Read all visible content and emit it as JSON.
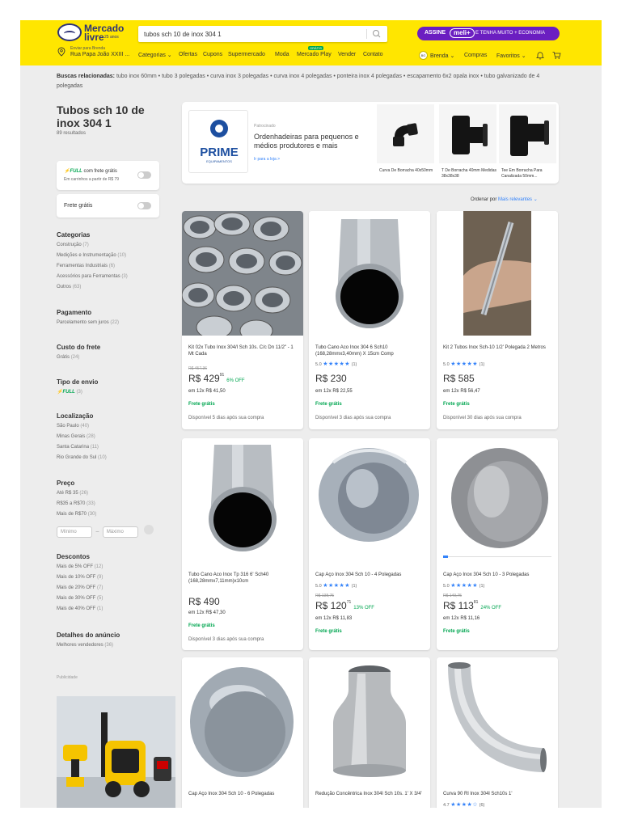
{
  "header": {
    "logo_line1": "Mercado",
    "logo_line2": "livre",
    "logo_line3": "25 anos",
    "search_value": "tubos sch 10 de inox 304 1",
    "promo_assine": "ASSINE",
    "promo_meli": "meli+",
    "promo_text": "E TENHA MUITO + ECONOMIA",
    "location_line1": "Enviar para Brenda",
    "location_line2": "Rua Papa João XXIII ...",
    "nav": [
      "Categorias ⌄",
      "Ofertas",
      "Cupons",
      "Supermercado",
      "Moda",
      "Mercado Play",
      "Vender",
      "Contato"
    ],
    "nav_badge": "GRÁTIS",
    "avatar_initials": "BG",
    "account": [
      "Brenda ⌄",
      "Compras",
      "Favoritos ⌄"
    ]
  },
  "related": {
    "label": "Buscas relacionadas:",
    "items": "tubo inox 60mm  •  tubo 3 polegadas  •  curva inox 3 polegadas  •  curva inox 4 polegadas  •  ponteira inox 4 polegadas  •  escapamento 6x2 opala inox  •  tubo galvanizado de 4 polegadas"
  },
  "left": {
    "title": "Tubos sch 10 de inox 304 1",
    "results": "89 resultados",
    "full_badge": "⚡FULL",
    "full_label": "com frete grátis",
    "full_sub": "Em carrinhos a partir de R$ 79",
    "frete_label": "Frete grátis",
    "filters": [
      {
        "title": "Categorias",
        "items": [
          [
            "Construção",
            "(7)"
          ],
          [
            "Medições e Instrumentação",
            "(10)"
          ],
          [
            "Ferramentas Industriais",
            "(6)"
          ],
          [
            "Acessórios para Ferramentas",
            "(3)"
          ],
          [
            "Outros",
            "(63)"
          ]
        ]
      },
      {
        "title": "Pagamento",
        "items": [
          [
            "Parcelamento sem juros",
            "(22)"
          ]
        ]
      },
      {
        "title": "Custo do frete",
        "items": [
          [
            "Grátis",
            "(24)"
          ]
        ]
      },
      {
        "title": "Tipo de envio",
        "items": [
          [
            "⚡FULL",
            "(3)"
          ]
        ]
      },
      {
        "title": "Localização",
        "items": [
          [
            "São Paulo",
            "(40)"
          ],
          [
            "Minas Gerais",
            "(28)"
          ],
          [
            "Santa Catarina",
            "(11)"
          ],
          [
            "Rio Grande do Sul",
            "(10)"
          ]
        ]
      },
      {
        "title": "Preço",
        "items": [
          [
            "Até R$ 35",
            "(26)"
          ],
          [
            "R$35 a R$70",
            "(33)"
          ],
          [
            "Mais de R$70",
            "(30)"
          ]
        ]
      },
      {
        "title": "Descontos",
        "items": [
          [
            "Mais de 5% OFF",
            "(12)"
          ],
          [
            "Mais de 10% OFF",
            "(9)"
          ],
          [
            "Mais de 20% OFF",
            "(7)"
          ],
          [
            "Mais de 30% OFF",
            "(5)"
          ],
          [
            "Mais de 40% OFF",
            "(1)"
          ]
        ]
      },
      {
        "title": "Detalhes do anúncio",
        "items": [
          [
            "Melhores vendedores",
            "(36)"
          ]
        ]
      }
    ],
    "price_min": "Mínimo",
    "price_max": "Máximo",
    "ad_label": "Publicidade"
  },
  "sponsored": {
    "brand": "PRIME",
    "brand_sub": "EQUIPAMENTOS",
    "tag": "Patrocinado",
    "text": "Ordenhadeiras para pequenos e médios produtores e mais",
    "link": "Ir para a loja  >",
    "items": [
      "Curva De Borracha 40x50mm",
      "T De Borracha 40mm Medidas 38x38x38",
      "Tee Em Borracha Para Canalizada 50mm..."
    ]
  },
  "sort": {
    "label": "Ordenar por",
    "value": "Mais relevantes ⌄"
  },
  "products": [
    {
      "title": "Kit 02x Tubo Inox 304/l Sch 10s. C/c Dn 11/2\" - 1 Mt Cada",
      "rating": "",
      "old": "R$ 457,36",
      "price": "R$ 429",
      "cents": "91",
      "off": "6% OFF",
      "inst": "em 12x R$ 41,50",
      "frete": "Frete grátis",
      "disp": "Disponível 5 dias após sua compra"
    },
    {
      "title": "Tubo Cano Aco Inox 304 6 Sch10 (168,28mmx3,40mm) X 15cm Comp",
      "rating": "5.0",
      "reviews": "(1)",
      "old": "",
      "price": "R$ 230",
      "cents": "",
      "off": "",
      "inst": "em 12x R$ 22,55",
      "frete": "Frete grátis",
      "disp": "Disponível 3 dias após sua compra"
    },
    {
      "title": "Kit 2 Tubos Inox Sch-10 1/2' Polegada 2 Metros",
      "rating": "5.0",
      "reviews": "(1)",
      "old": "",
      "price": "R$ 585",
      "cents": "",
      "off": "",
      "inst": "em 12x R$ 56,47",
      "frete": "Frete grátis",
      "disp": "Disponível 30 dias após sua compra"
    },
    {
      "title": "Tubo Cano Aco Inox Tp 316 6' Sch40 (168,28mmx7,11mm)x10cm",
      "rating": "",
      "old": "",
      "price": "R$ 490",
      "cents": "",
      "off": "",
      "inst": "em 12x R$ 47,30",
      "frete": "Frete grátis",
      "disp": "Disponível 3 dias após sua compra"
    },
    {
      "title": "Cap Aço Inox 304 Sch 10 - 4 Polegadas",
      "rating": "5.0",
      "reviews": "(1)",
      "old": "R$ 138,75",
      "price": "R$ 120",
      "cents": "71",
      "off": "13% OFF",
      "inst": "em 12x R$ 11,83",
      "frete": "Frete grátis",
      "disp": ""
    },
    {
      "title": "Cap Aço Inox 304 Sch 10 - 3 Polegadas",
      "rating": "5.0",
      "reviews": "(1)",
      "old": "R$ 149,75",
      "price": "R$ 113",
      "cents": "81",
      "off": "24% OFF",
      "inst": "em 12x R$ 11,16",
      "frete": "Frete grátis",
      "disp": ""
    },
    {
      "title": "Cap Aço Inox 304 Sch 10 - 6 Polegadas",
      "rating": "",
      "old": "",
      "price": "",
      "cents": "",
      "off": "",
      "inst": "",
      "frete": "",
      "disp": ""
    },
    {
      "title": "Redução Concêntrica Inox 304l Sch 10s. 1' X 3/4'",
      "rating": "",
      "old": "",
      "price": "",
      "cents": "",
      "off": "",
      "inst": "",
      "frete": "",
      "disp": ""
    },
    {
      "title": "Curva 90 Rl Inox 304l Sch10s 1'",
      "rating": "4.7",
      "reviews": "(6)",
      "old": "",
      "price": "",
      "cents": "",
      "off": "",
      "inst": "",
      "frete": "",
      "disp": ""
    }
  ],
  "colors": {
    "header": "#ffe600",
    "accent": "#3483fa",
    "green": "#00a650",
    "promo": "#6b1ec1"
  }
}
